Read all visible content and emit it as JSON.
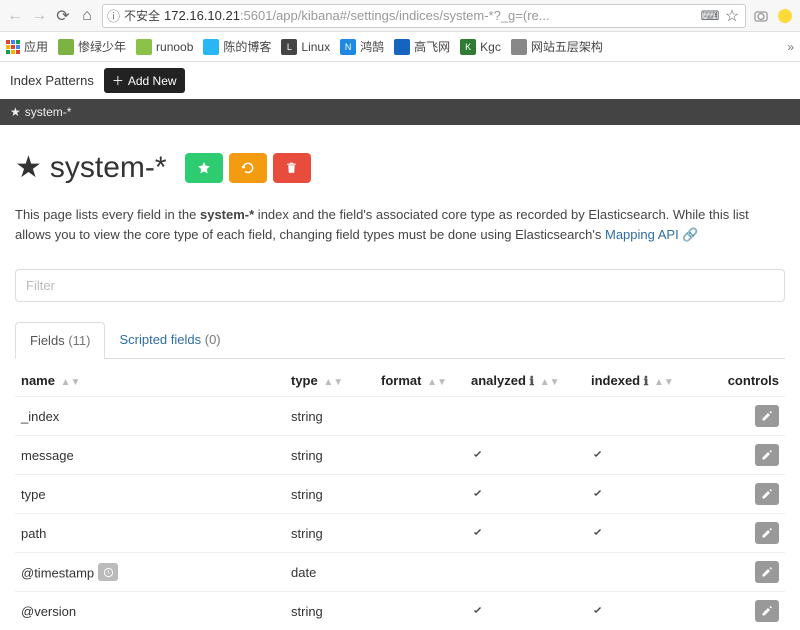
{
  "browser": {
    "insecure_label": "不安全",
    "url_host": "172.16.10.21",
    "url_rest": ":5601/app/kibana#/settings/indices/system-*?_g=(re..."
  },
  "bookmarks": {
    "apps": "应用",
    "items": [
      "惨绿少年",
      "runoob",
      "陈的博客",
      "Linux",
      "鸿鹄",
      "高飞网",
      "Kgc",
      "网站五层架构"
    ]
  },
  "topbar": {
    "index_patterns": "Index Patterns",
    "add_new": "Add New"
  },
  "breadcrumb": "system-*",
  "title": "system-*",
  "desc": {
    "part1": "This page lists every field in the ",
    "bold": "system-*",
    "part2": " index and the field's associated core type as recorded by Elasticsearch. While this list allows you to view the core type of each field, changing field types must be done using Elasticsearch's ",
    "link": "Mapping API"
  },
  "filter_placeholder": "Filter",
  "tabs": {
    "fields": {
      "label": "Fields",
      "count": "(11)"
    },
    "scripted": {
      "label": "Scripted fields",
      "count": "(0)"
    }
  },
  "columns": {
    "name": "name",
    "type": "type",
    "format": "format",
    "analyzed": "analyzed",
    "indexed": "indexed",
    "controls": "controls"
  },
  "rows": [
    {
      "name": "_index",
      "type": "string",
      "analyzed": false,
      "indexed": false,
      "clock": false
    },
    {
      "name": "message",
      "type": "string",
      "analyzed": true,
      "indexed": true,
      "clock": false
    },
    {
      "name": "type",
      "type": "string",
      "analyzed": true,
      "indexed": true,
      "clock": false
    },
    {
      "name": "path",
      "type": "string",
      "analyzed": true,
      "indexed": true,
      "clock": false
    },
    {
      "name": "@timestamp",
      "type": "date",
      "analyzed": false,
      "indexed": false,
      "clock": true
    },
    {
      "name": "@version",
      "type": "string",
      "analyzed": true,
      "indexed": true,
      "clock": false
    }
  ]
}
